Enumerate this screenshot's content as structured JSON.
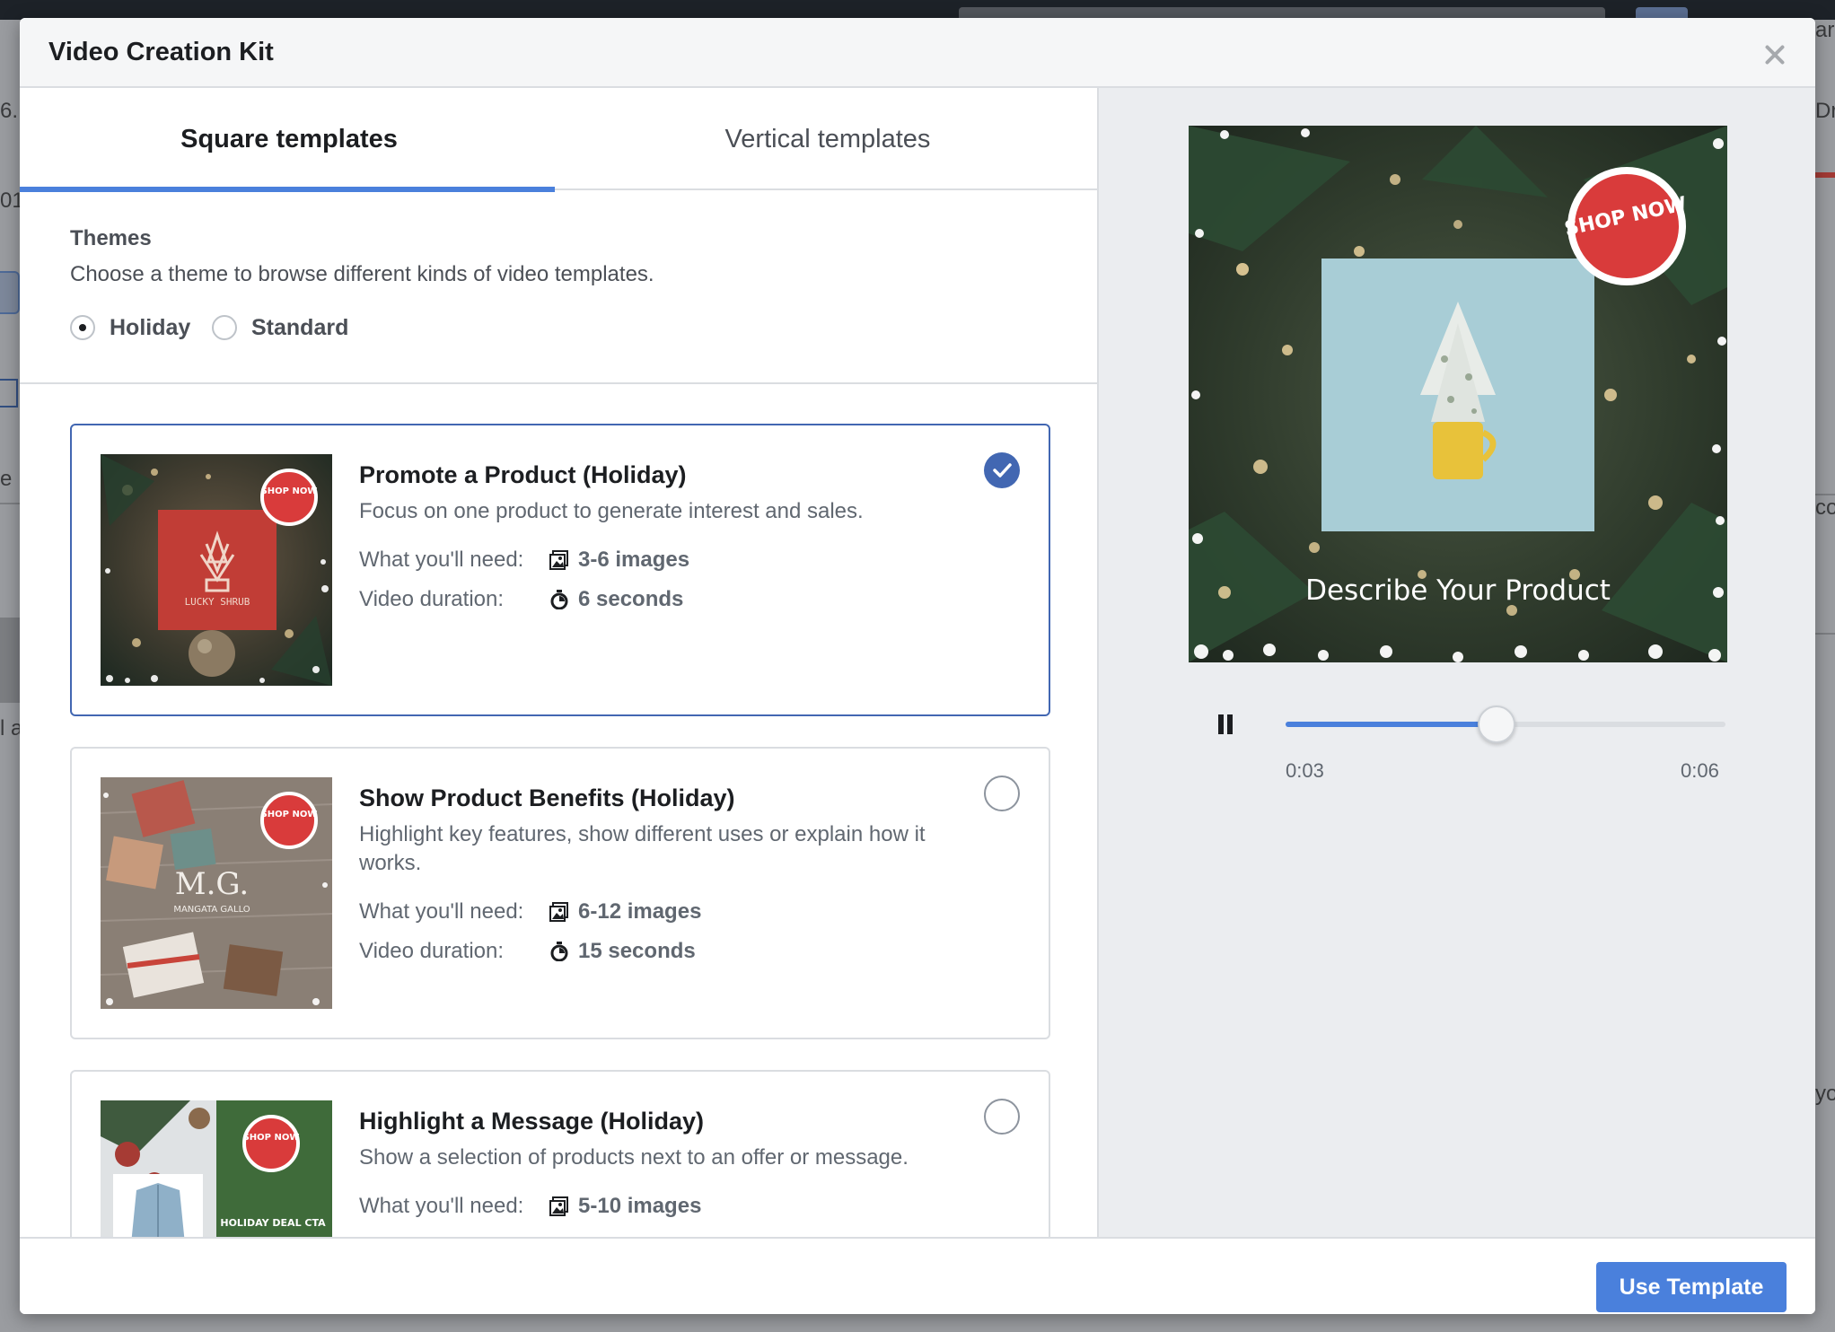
{
  "background": {
    "left_fragments": [
      "6..",
      "01",
      "e",
      "l a"
    ],
    "right_fragments": [
      "are",
      "Dr",
      "co",
      "yo"
    ]
  },
  "modal": {
    "title": "Video Creation Kit",
    "close_icon": "close-icon"
  },
  "tabs": [
    {
      "label": "Square templates",
      "active": true
    },
    {
      "label": "Vertical templates",
      "active": false
    }
  ],
  "themes": {
    "title": "Themes",
    "description": "Choose a theme to browse different kinds of video templates.",
    "options": [
      {
        "label": "Holiday",
        "checked": true
      },
      {
        "label": "Standard",
        "checked": false
      }
    ]
  },
  "templates": [
    {
      "title": "Promote a Product (Holiday)",
      "description": "Focus on one product to generate interest and sales.",
      "needs_label": "What you'll need:",
      "needs_value": "3-6 images",
      "duration_label": "Video duration:",
      "duration_value": "6 seconds",
      "selected": true,
      "thumb": {
        "badge": "SHOP NOW",
        "brand": "LUCKY SHRUB"
      }
    },
    {
      "title": "Show Product Benefits (Holiday)",
      "description": "Highlight key features, show different uses or explain how it works.",
      "needs_label": "What you'll need:",
      "needs_value": "6-12 images",
      "duration_label": "Video duration:",
      "duration_value": "15 seconds",
      "selected": false,
      "thumb": {
        "badge": "SHOP NOW",
        "brand": "M.G.",
        "brand_sub": "MANGATA GALLO"
      }
    },
    {
      "title": "Highlight a Message (Holiday)",
      "description": "Show a selection of products next to an offer or message.",
      "needs_label": "What you'll need:",
      "needs_value": "5-10 images",
      "selected": false,
      "thumb": {
        "badge": "SHOP NOW",
        "caption": "HOLIDAY DEAL CTA"
      }
    }
  ],
  "preview": {
    "badge": "SHOP NOW",
    "caption": "Describe Your Product",
    "current_time": "0:03",
    "total_time": "0:06",
    "progress": 0.48,
    "icons": {
      "pause": "pause-icon",
      "image": "image-icon",
      "timer": "stopwatch-icon"
    }
  },
  "footer": {
    "primary_button": "Use Template"
  },
  "colors": {
    "accent": "#4a80dc",
    "selected_border": "#4267b2",
    "badge_red": "#d93b3b"
  }
}
